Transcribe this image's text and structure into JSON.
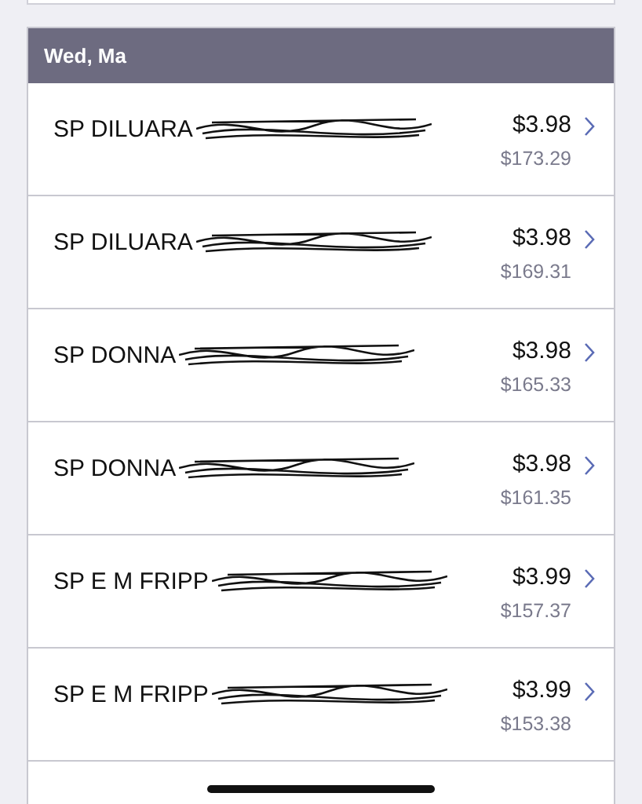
{
  "date_header": "Wed, Ma",
  "transactions": [
    {
      "description": "SP DILUARA",
      "amount": "$3.98",
      "balance": "$173.29"
    },
    {
      "description": "SP DILUARA",
      "amount": "$3.98",
      "balance": "$169.31"
    },
    {
      "description": "SP DONNA",
      "amount": "$3.98",
      "balance": "$165.33"
    },
    {
      "description": "SP DONNA",
      "amount": "$3.98",
      "balance": "$161.35"
    },
    {
      "description": "SP E M FRIPP",
      "amount": "$3.99",
      "balance": "$157.37"
    },
    {
      "description": "SP E M FRIPP",
      "amount": "$3.99",
      "balance": "$153.38"
    }
  ]
}
